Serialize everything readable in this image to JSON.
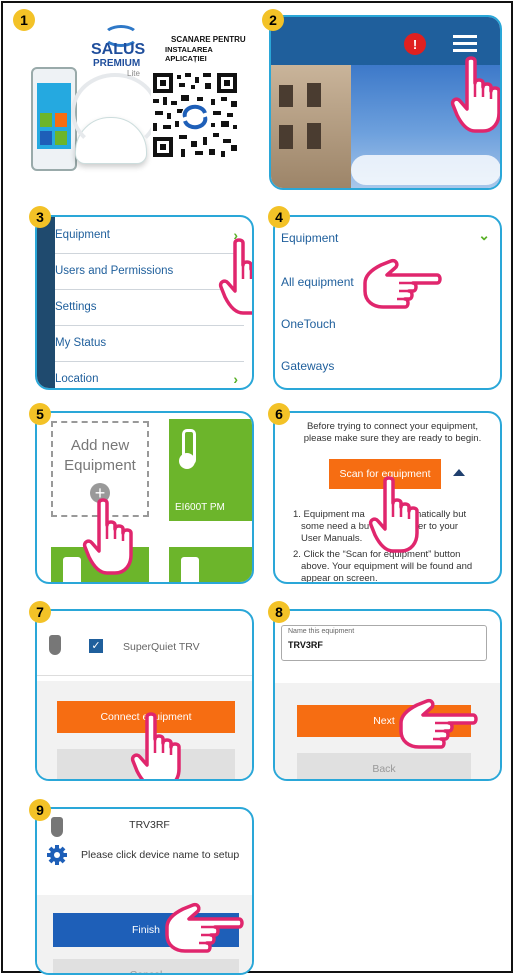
{
  "badges": [
    "1",
    "2",
    "3",
    "4",
    "5",
    "6",
    "7",
    "8",
    "9"
  ],
  "step1": {
    "brand_line1": "SALUS",
    "brand_line2": "PREMIUM",
    "brand_line3": "Lite",
    "scan_text_1": "SCANARE PENTRU",
    "scan_text_2": "INSTALAREA APLICAȚIEI"
  },
  "step2": {
    "alert_icon": "!"
  },
  "step3": {
    "items": [
      {
        "label": "Equipment"
      },
      {
        "label": "Users and Permissions"
      },
      {
        "label": "Settings"
      },
      {
        "label": "My Status"
      },
      {
        "label": "Location"
      }
    ]
  },
  "step4": {
    "items": [
      {
        "label": "Equipment"
      },
      {
        "label": "All equipment"
      },
      {
        "label": "OneTouch"
      },
      {
        "label": "Gateways"
      }
    ]
  },
  "step5": {
    "add_line1": "Add new",
    "add_line2": "Equipment",
    "device_label": "EI600T PM"
  },
  "step6": {
    "intro": "Before trying to connect your equipment, please make sure they are ready to begin.",
    "scan_button": "Scan for equipment",
    "item1_a": "1. Equipment ma",
    "item1_b": "automatically but",
    "item1_c": "some need a bu",
    "item1_d": "s. Refer to your",
    "item1_e": "User Manuals.",
    "item2_a": "2. Click the “Scan for equipment” button",
    "item2_b": "above. Your equipment will be found and",
    "item2_c": "appear on screen."
  },
  "step7": {
    "device_name": "SuperQuiet TRV",
    "connect_button": "Connect equipment"
  },
  "step8": {
    "field_label": "Name this equipment",
    "field_value": "TRV3RF",
    "next_button": "Next",
    "back_button": "Back"
  },
  "step9": {
    "device_name": "TRV3RF",
    "setup_text": "Please click device name to setup",
    "finish_button": "Finish",
    "cancel_button": "Cancel"
  },
  "colors": {
    "panel_border": "#2aa7d8",
    "badge": "#f3c227",
    "orange": "#f66d12",
    "green": "#6cb52b",
    "blue_button": "#1e5fb8",
    "hand_outline": "#e0266d"
  }
}
